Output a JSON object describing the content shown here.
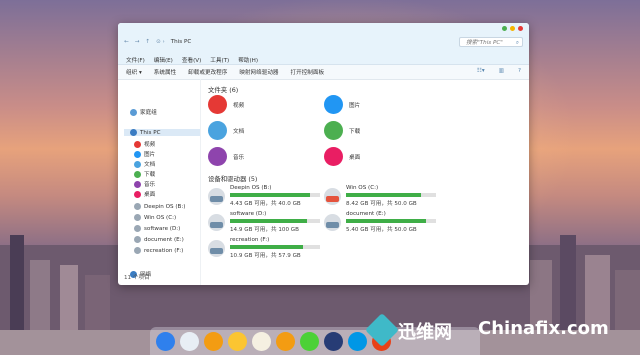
{
  "window": {
    "address_path": "This PC",
    "search_placeholder": "搜索\"This PC\"",
    "menu": [
      "文件(F)",
      "编辑(E)",
      "查看(V)",
      "工具(T)",
      "帮助(H)"
    ],
    "toolbar": [
      "组织 ▾",
      "系统属性",
      "卸载或更改程序",
      "映射网络驱动器",
      "打开控制面板"
    ]
  },
  "sidebar": {
    "homegroup": "家庭组",
    "this_pc": "This PC",
    "items": [
      "视频",
      "图片",
      "文档",
      "下载",
      "音乐",
      "桌面"
    ],
    "drives": [
      "Deepin OS (B:)",
      "Win OS (C:)",
      "software (D:)",
      "document (E:)",
      "recreation (F:)"
    ],
    "network": "网络"
  },
  "folders": {
    "title": "文件夹 (6)",
    "items": [
      {
        "name": "视频",
        "icon": "video-folder-icon",
        "color": "#e53935"
      },
      {
        "name": "图片",
        "icon": "pictures-folder-icon",
        "color": "#2196f3"
      },
      {
        "name": "文档",
        "icon": "documents-folder-icon",
        "color": "#4aa3df"
      },
      {
        "name": "下载",
        "icon": "downloads-folder-icon",
        "color": "#4caf50"
      },
      {
        "name": "音乐",
        "icon": "music-folder-icon",
        "color": "#8e44ad"
      },
      {
        "name": "桌面",
        "icon": "desktop-folder-icon",
        "color": "#e91e63"
      }
    ]
  },
  "drives": {
    "title": "设备和驱动器 (5)",
    "items": [
      {
        "name": "Deepin OS (B:)",
        "info": "4.43 GB 可用，共 40.0 GB",
        "used": 0.89
      },
      {
        "name": "Win OS (C:)",
        "info": "8.42 GB 可用，共 50.0 GB",
        "used": 0.83
      },
      {
        "name": "software (D:)",
        "info": "14.9 GB 可用，共 100 GB",
        "used": 0.85
      },
      {
        "name": "document (E:)",
        "info": "5.40 GB 可用，共 50.0 GB",
        "used": 0.89
      },
      {
        "name": "recreation (F:)",
        "info": "10.9 GB 可用，共 57.9 GB",
        "used": 0.81
      }
    ]
  },
  "status": "11 个项目",
  "watermark": {
    "brand_cn": "迅维网",
    "brand_en": "Chinafix.com"
  },
  "colors": {
    "accent": "#3fae47",
    "title_bg": "#e7f3fb"
  }
}
